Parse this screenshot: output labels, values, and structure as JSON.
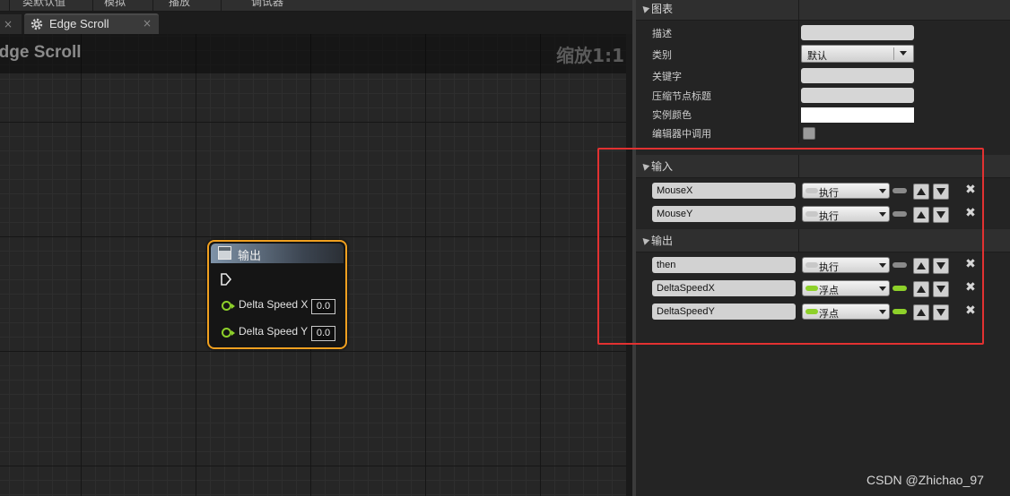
{
  "menubar": {
    "items": [
      "类默认值",
      "模拟",
      "播放",
      "调试器"
    ]
  },
  "tabs": {
    "prev_close": "×",
    "active_label": "Edge Scroll",
    "active_close": "×"
  },
  "graph": {
    "title": "Edge Scroll",
    "zoom": "缩放1:1"
  },
  "node": {
    "title": "输出",
    "pins": [
      {
        "label": "Delta Speed X",
        "value": "0.0"
      },
      {
        "label": "Delta Speed Y",
        "value": "0.0"
      }
    ]
  },
  "details": {
    "graph_section": "图表",
    "props": {
      "description": "描述",
      "category": "类别",
      "category_value": "默认",
      "keywords": "关键字",
      "compact_title": "压缩节点标题",
      "instance_color": "实例颜色",
      "call_in_editor": "编辑器中调用"
    },
    "inputs_section": "输入",
    "outputs_section": "输出",
    "inputs": [
      {
        "name": "MouseX",
        "type": "执行",
        "type_color": "#c8c8c8"
      },
      {
        "name": "MouseY",
        "type": "执行",
        "type_color": "#c8c8c8"
      }
    ],
    "outputs": [
      {
        "name": "then",
        "type": "执行",
        "type_color": "#c8c8c8"
      },
      {
        "name": "DeltaSpeedX",
        "type": "浮点",
        "type_color": "#8ed12a"
      },
      {
        "name": "DeltaSpeedY",
        "type": "浮点",
        "type_color": "#8ed12a"
      }
    ],
    "remove_glyph": "✖"
  },
  "colors": {
    "node_border": "#f0a020",
    "float_pin": "#8ed12a",
    "highlight": "#e23131"
  },
  "watermark": "CSDN @Zhichao_97"
}
